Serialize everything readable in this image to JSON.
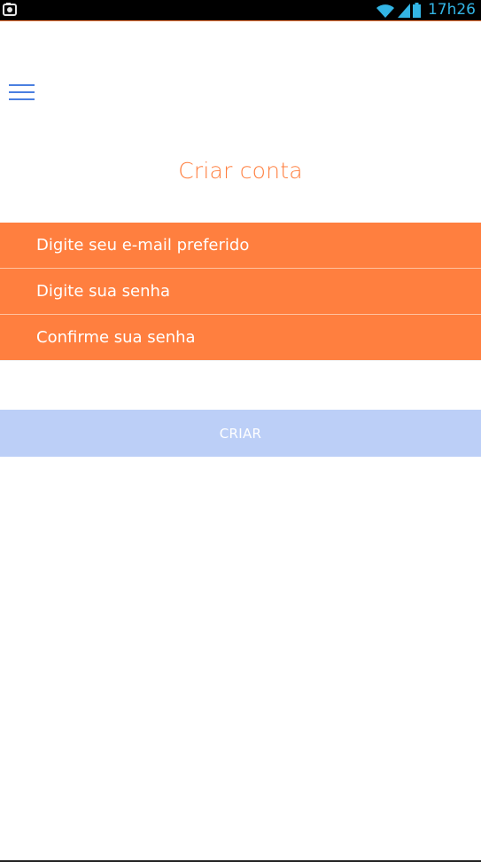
{
  "status_bar": {
    "left_icon": "notification-icon",
    "wifi_icon": "wifi-icon",
    "signal_icon": "signal-icon",
    "battery_icon": "battery-icon",
    "time": "17h26",
    "time_color": "#33b5e5",
    "background": "#000000"
  },
  "header": {
    "menu_icon": "hamburger-menu-icon",
    "menu_color": "#4a7fe0"
  },
  "page": {
    "title": "Criar conta",
    "accent_color": "#ff7f3f"
  },
  "form": {
    "email_placeholder": "Digite seu e-mail preferido",
    "email_value": "",
    "password_placeholder": "Digite sua senha",
    "password_value": "",
    "confirm_placeholder": "Confirme sua senha",
    "confirm_value": "",
    "field_color": "#ff7f3f"
  },
  "actions": {
    "create_label": "CRIAR",
    "create_button_color": "#bccff7"
  }
}
